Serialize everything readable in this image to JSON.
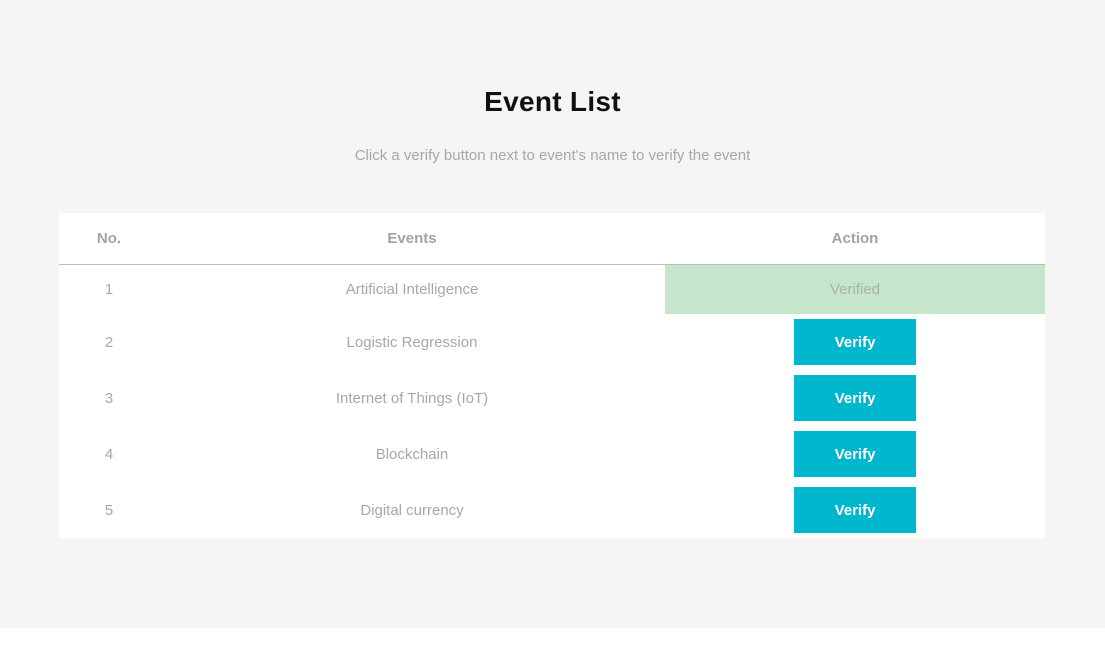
{
  "page": {
    "title": "Event List",
    "subtitle": "Click a verify button next to event's name to verify the event"
  },
  "table": {
    "headers": {
      "no": "No.",
      "events": "Events",
      "action": "Action"
    },
    "rows": [
      {
        "no": "1",
        "event": "Artificial Intelligence",
        "status": "Verified"
      },
      {
        "no": "2",
        "event": "Logistic Regression",
        "action_label": "Verify"
      },
      {
        "no": "3",
        "event": "Internet of Things (IoT)",
        "action_label": "Verify"
      },
      {
        "no": "4",
        "event": "Blockchain",
        "action_label": "Verify"
      },
      {
        "no": "5",
        "event": "Digital currency",
        "action_label": "Verify"
      }
    ]
  },
  "colors": {
    "page_background": "#f6f4f4",
    "verify_button": "#00b7ce",
    "verified_background": "#c5e6cb"
  }
}
